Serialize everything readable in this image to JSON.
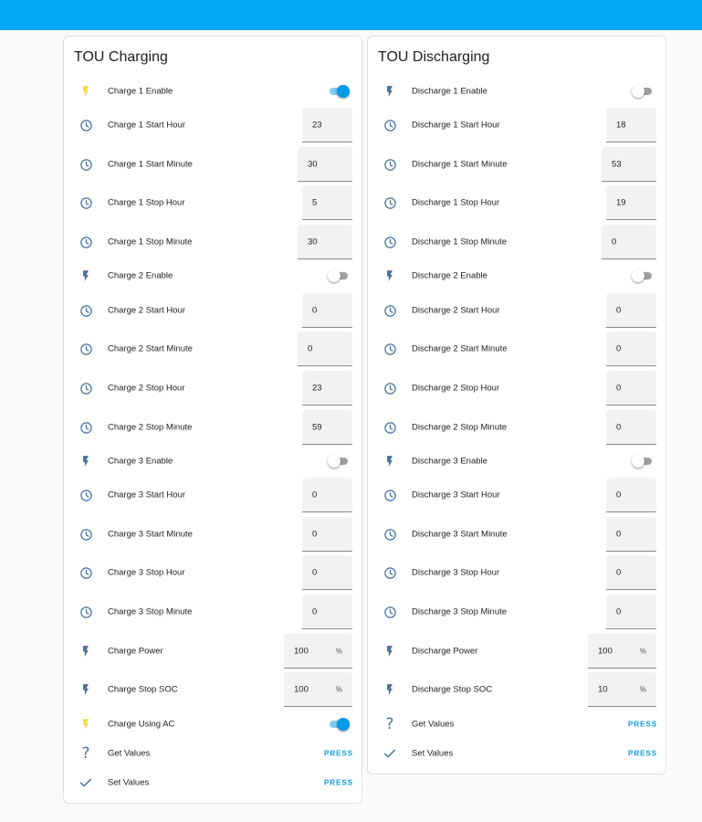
{
  "colors": {
    "header": "#03a9f4",
    "accent": "#039be5",
    "icon": "#44739e",
    "icon_active": "#fdd835"
  },
  "charging": {
    "title": "TOU Charging",
    "rows": [
      {
        "kind": "switch",
        "icon": "flash-icon",
        "active": true,
        "label": "Charge 1 Enable",
        "on": true
      },
      {
        "kind": "number",
        "icon": "clock-icon",
        "label": "Charge 1 Start Hour",
        "value": "23",
        "unit": ""
      },
      {
        "kind": "number",
        "icon": "clock-icon",
        "label": "Charge 1 Start Minute",
        "value": "30",
        "unit": ""
      },
      {
        "kind": "number",
        "icon": "clock-icon",
        "label": "Charge 1 Stop Hour",
        "value": "5",
        "unit": ""
      },
      {
        "kind": "number",
        "icon": "clock-icon",
        "label": "Charge 1 Stop Minute",
        "value": "30",
        "unit": ""
      },
      {
        "kind": "switch",
        "icon": "flash-icon",
        "active": false,
        "label": "Charge 2 Enable",
        "on": false
      },
      {
        "kind": "number",
        "icon": "clock-icon",
        "label": "Charge 2 Start Hour",
        "value": "0",
        "unit": ""
      },
      {
        "kind": "number",
        "icon": "clock-icon",
        "label": "Charge 2 Start Minute",
        "value": "0",
        "unit": ""
      },
      {
        "kind": "number",
        "icon": "clock-icon",
        "label": "Charge 2 Stop Hour",
        "value": "23",
        "unit": ""
      },
      {
        "kind": "number",
        "icon": "clock-icon",
        "label": "Charge 2 Stop Minute",
        "value": "59",
        "unit": ""
      },
      {
        "kind": "switch",
        "icon": "flash-icon",
        "active": false,
        "label": "Charge 3 Enable",
        "on": false
      },
      {
        "kind": "number",
        "icon": "clock-icon",
        "label": "Charge 3 Start Hour",
        "value": "0",
        "unit": ""
      },
      {
        "kind": "number",
        "icon": "clock-icon",
        "label": "Charge 3 Start Minute",
        "value": "0",
        "unit": ""
      },
      {
        "kind": "number",
        "icon": "clock-icon",
        "label": "Charge 3 Stop Hour",
        "value": "0",
        "unit": ""
      },
      {
        "kind": "number",
        "icon": "clock-icon",
        "label": "Charge 3 Stop Minute",
        "value": "0",
        "unit": ""
      },
      {
        "kind": "number",
        "icon": "flash-icon",
        "label": "Charge Power",
        "value": "100",
        "unit": "%"
      },
      {
        "kind": "number",
        "icon": "flash-icon",
        "label": "Charge Stop SOC",
        "value": "100",
        "unit": "%"
      },
      {
        "kind": "switch",
        "icon": "flash-icon",
        "active": true,
        "label": "Charge Using AC",
        "on": true
      },
      {
        "kind": "button",
        "icon": "help-icon",
        "label": "Get Values",
        "action": "PRESS"
      },
      {
        "kind": "button",
        "icon": "check-icon",
        "label": "Set Values",
        "action": "PRESS"
      }
    ]
  },
  "discharging": {
    "title": "TOU Discharging",
    "rows": [
      {
        "kind": "switch",
        "icon": "flash-icon",
        "active": false,
        "label": "Discharge 1 Enable",
        "on": false
      },
      {
        "kind": "number",
        "icon": "clock-icon",
        "label": "Discharge 1 Start Hour",
        "value": "18",
        "unit": ""
      },
      {
        "kind": "number",
        "icon": "clock-icon",
        "label": "Discharge 1 Start Minute",
        "value": "53",
        "unit": ""
      },
      {
        "kind": "number",
        "icon": "clock-icon",
        "label": "Discharge 1 Stop Hour",
        "value": "19",
        "unit": ""
      },
      {
        "kind": "number",
        "icon": "clock-icon",
        "label": "Discharge 1 Stop Minute",
        "value": "0",
        "unit": ""
      },
      {
        "kind": "switch",
        "icon": "flash-icon",
        "active": false,
        "label": "Discharge 2 Enable",
        "on": false
      },
      {
        "kind": "number",
        "icon": "clock-icon",
        "label": "Discharge 2 Start Hour",
        "value": "0",
        "unit": ""
      },
      {
        "kind": "number",
        "icon": "clock-icon",
        "label": "Discharge 2 Start Minute",
        "value": "0",
        "unit": ""
      },
      {
        "kind": "number",
        "icon": "clock-icon",
        "label": "Discharge 2 Stop Hour",
        "value": "0",
        "unit": ""
      },
      {
        "kind": "number",
        "icon": "clock-icon",
        "label": "Discharge 2 Stop Minute",
        "value": "0",
        "unit": ""
      },
      {
        "kind": "switch",
        "icon": "flash-icon",
        "active": false,
        "label": "Discharge 3 Enable",
        "on": false
      },
      {
        "kind": "number",
        "icon": "clock-icon",
        "label": "Discharge 3 Start Hour",
        "value": "0",
        "unit": ""
      },
      {
        "kind": "number",
        "icon": "clock-icon",
        "label": "Discharge 3 Start Minute",
        "value": "0",
        "unit": ""
      },
      {
        "kind": "number",
        "icon": "clock-icon",
        "label": "Discharge 3 Stop Hour",
        "value": "0",
        "unit": ""
      },
      {
        "kind": "number",
        "icon": "clock-icon",
        "label": "Discharge 3 Stop Minute",
        "value": "0",
        "unit": ""
      },
      {
        "kind": "number",
        "icon": "flash-icon",
        "label": "Discharge Power",
        "value": "100",
        "unit": "%"
      },
      {
        "kind": "number",
        "icon": "flash-icon",
        "label": "Discharge Stop SOC",
        "value": "10",
        "unit": "%"
      },
      {
        "kind": "button",
        "icon": "help-icon",
        "label": "Get Values",
        "action": "PRESS"
      },
      {
        "kind": "button",
        "icon": "check-icon",
        "label": "Set Values",
        "action": "PRESS"
      }
    ]
  }
}
